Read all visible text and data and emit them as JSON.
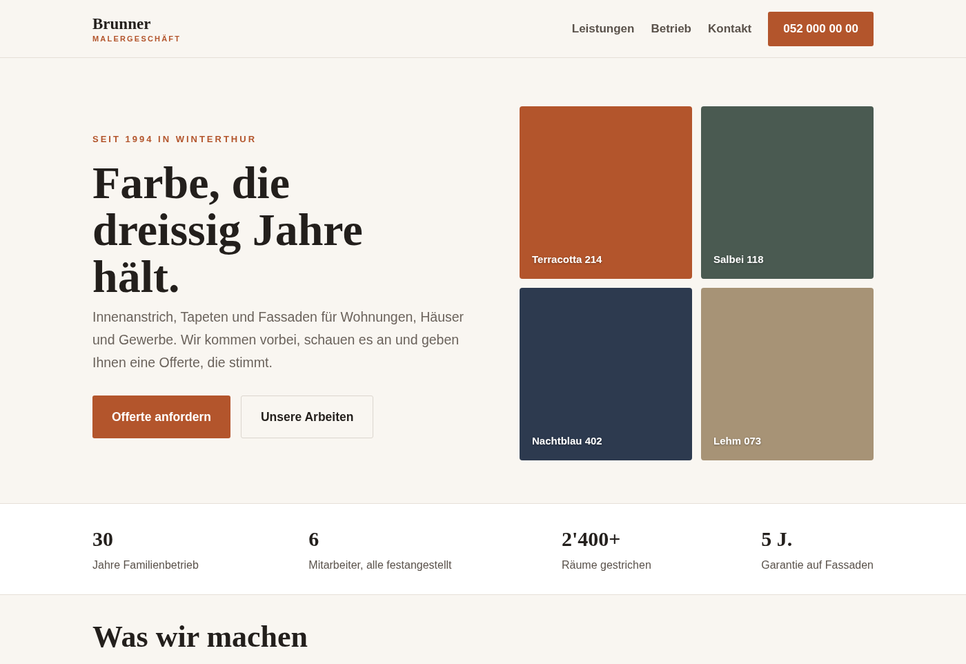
{
  "header": {
    "brand": "Brunner",
    "tagline": "MALERGESCHÄFT",
    "nav": [
      "Leistungen",
      "Betrieb",
      "Kontakt"
    ],
    "phone": "052 000 00 00"
  },
  "hero": {
    "eyebrow": "SEIT 1994 IN WINTERTHUR",
    "title": "Farbe, die dreissig Jahre hält.",
    "text": "Innenanstrich, Tapeten und Fassaden für Wohnungen, Häuser und Gewerbe. Wir kommen vorbei, schauen es an und geben Ihnen eine Offerte, die stimmt.",
    "buttons": [
      {
        "label": "Offerte anfordern",
        "kind": "primary"
      },
      {
        "label": "Unsere Arbeiten",
        "kind": "secondary"
      }
    ],
    "swatches": [
      {
        "name": "Terracotta 214",
        "color": "#b3552c"
      },
      {
        "name": "Salbei 118",
        "color": "#4a5a51"
      },
      {
        "name": "Nachtblau 402",
        "color": "#2d3a4f"
      },
      {
        "name": "Lehm 073",
        "color": "#a79376"
      }
    ]
  },
  "stats": [
    {
      "value": "30",
      "label": "Jahre Familienbetrieb"
    },
    {
      "value": "6",
      "label": "Mitarbeiter, alle festangestellt"
    },
    {
      "value": "2'400+",
      "label": "Räume gestrichen"
    },
    {
      "value": "5 J.",
      "label": "Garantie auf Fassaden"
    }
  ],
  "section": {
    "title": "Was wir machen"
  }
}
